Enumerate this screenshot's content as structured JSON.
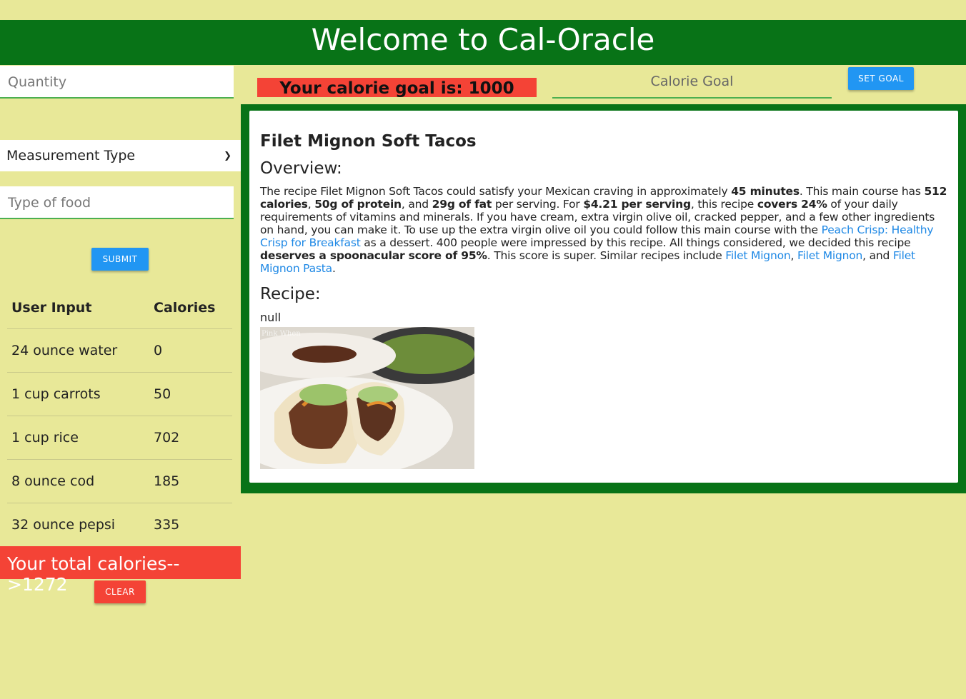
{
  "header": {
    "title": "Welcome to Cal-Oracle"
  },
  "form": {
    "quantity_placeholder": "Quantity",
    "measurement_placeholder": "Measurement Type",
    "food_placeholder": "Type of food",
    "submit_label": "SUBMIT"
  },
  "table": {
    "headers": [
      "User Input",
      "Calories"
    ],
    "rows": [
      {
        "input": "24 ounce water",
        "calories": "0"
      },
      {
        "input": "1 cup carrots",
        "calories": "50"
      },
      {
        "input": "1 cup rice",
        "calories": "702"
      },
      {
        "input": "8 ounce cod",
        "calories": "185"
      },
      {
        "input": "32 ounce pepsi",
        "calories": "335"
      }
    ]
  },
  "total": {
    "text": "Your total calories-->1272"
  },
  "clear_label": "CLEAR",
  "goal": {
    "label": "Your calorie goal is: 1000",
    "input_placeholder": "Calorie Goal",
    "set_label": "SET GOAL"
  },
  "recipe": {
    "title": "Filet Mignon Soft Tacos",
    "overview_heading": "Overview:",
    "summary": {
      "t1": "The recipe Filet Mignon Soft Tacos could satisfy your Mexican craving in approximately ",
      "b1": "45 minutes",
      "t2": ". This main course has ",
      "b2": "512 calories",
      "t3": ", ",
      "b3": "50g of protein",
      "t4": ", and ",
      "b4": "29g of fat",
      "t5": " per serving. For ",
      "b5": "$4.21 per serving",
      "t6": ", this recipe ",
      "b6": "covers 24%",
      "t7": " of your daily requirements of vitamins and minerals. If you have cream, extra virgin olive oil, cracked pepper, and a few other ingredients on hand, you can make it. To use up the extra virgin olive oil you could follow this main course with the ",
      "l1": "Peach Crisp: Healthy Crisp for Breakfast",
      "t8": " as a dessert. 400 people were impressed by this recipe. All things considered, we decided this recipe ",
      "b7": "deserves a spoonacular score of 95%",
      "t9": ". This score is super. Similar recipes include ",
      "l2": "Filet Mignon",
      "t10": ", ",
      "l3": "Filet Mignon",
      "t11": ", and ",
      "l4": "Filet Mignon Pasta",
      "t12": "."
    },
    "recipe_heading": "Recipe:",
    "instructions": "null",
    "image_watermark": "Pink When"
  },
  "colors": {
    "background": "#e8e898",
    "header": "#087317",
    "accent_red": "#f44336",
    "accent_blue": "#2196f3",
    "link": "#1e88e5"
  }
}
